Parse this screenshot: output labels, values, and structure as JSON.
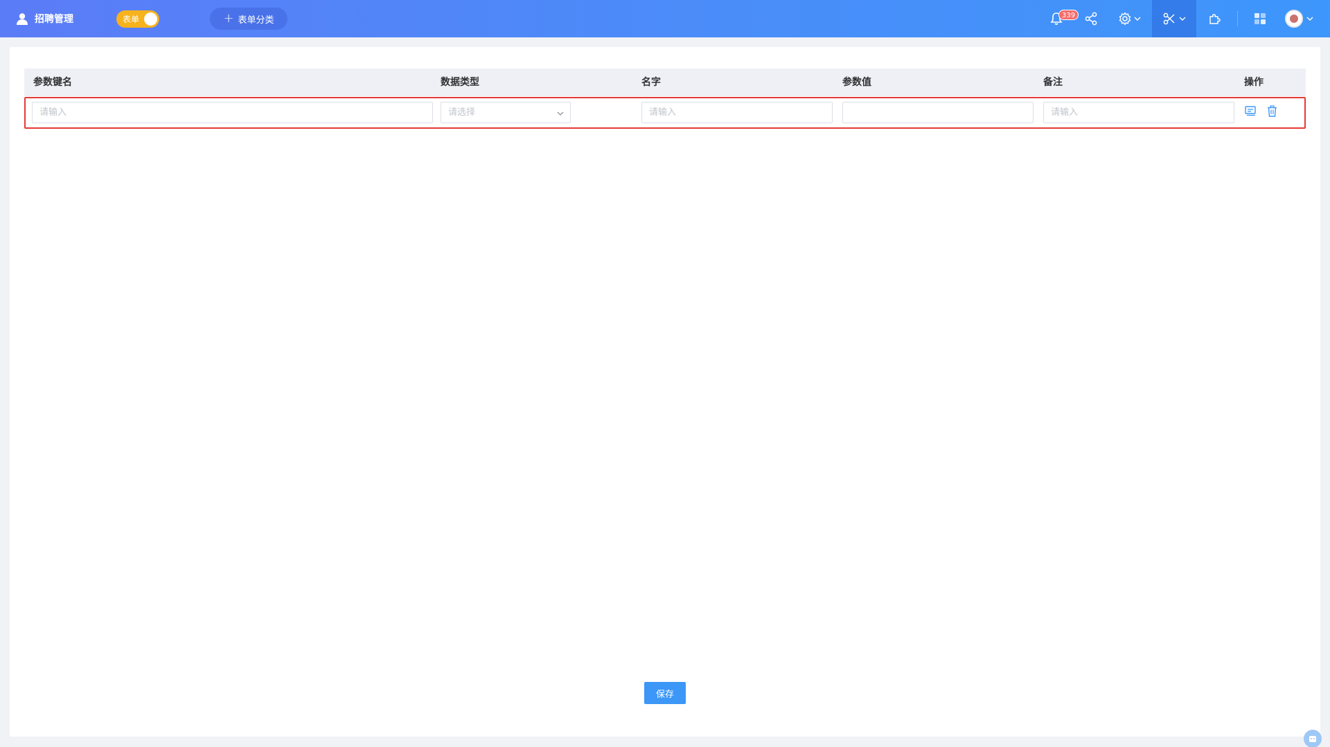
{
  "header": {
    "app_title": "招聘管理",
    "toggle_label": "表单",
    "add_category_label": "表单分类",
    "notification_count": "339",
    "icons": [
      "user-icon",
      "bell-icon",
      "share-icon",
      "gear-icon",
      "tools-icon",
      "puzzle-icon",
      "apps-icon",
      "avatar"
    ]
  },
  "table": {
    "columns": [
      "参数键名",
      "数据类型",
      "名字",
      "参数值",
      "备注",
      "操作"
    ],
    "row": {
      "key_placeholder": "请输入",
      "type_placeholder": "请选择",
      "name_placeholder": "请输入",
      "value_placeholder": "",
      "remark_placeholder": "请输入",
      "actions": [
        "copy-icon",
        "trash-icon"
      ]
    }
  },
  "footer": {
    "save_label": "保存"
  },
  "colors": {
    "topbar_start": "#5b7cf7",
    "topbar_end": "#3d96fb",
    "accent": "#3c97f7",
    "toggle": "#f7b21c",
    "badge": "#f56c6c",
    "highlight": "#e53935"
  }
}
